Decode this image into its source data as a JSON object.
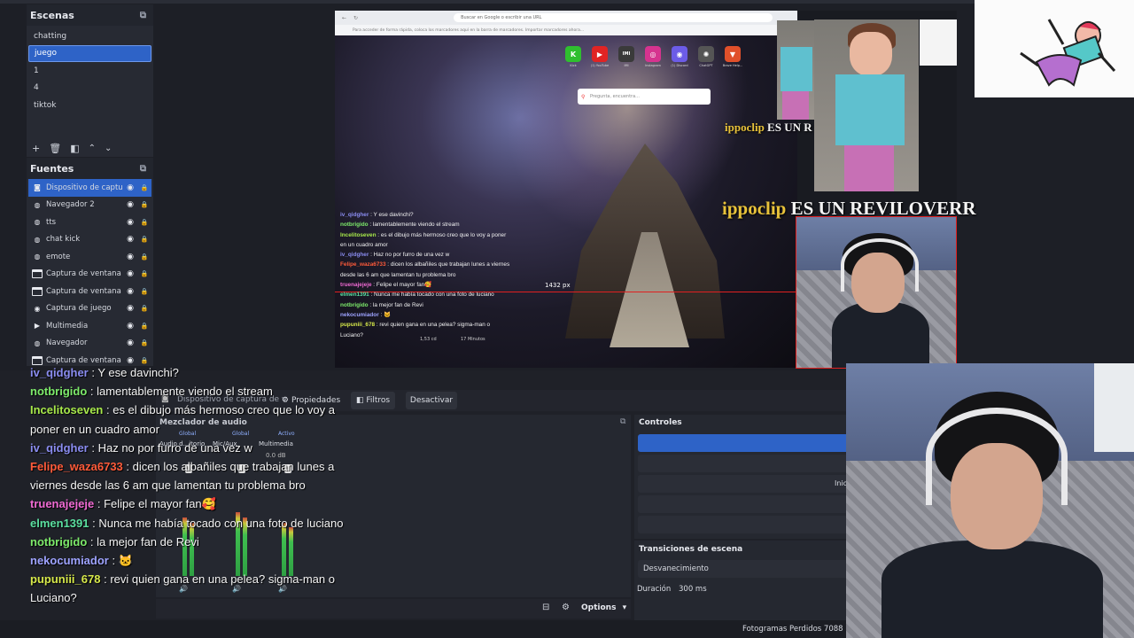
{
  "scenes": {
    "title": "Escenas",
    "items": [
      "chatting",
      "juego",
      "1",
      "4",
      "tiktok"
    ],
    "selected": "juego",
    "toolbar": [
      "+",
      "🗑",
      "◧",
      "^",
      "v"
    ]
  },
  "sources": {
    "title": "Fuentes",
    "items": [
      {
        "label": "Dispositivo de captur",
        "icon": "camera-icon"
      },
      {
        "label": "Navegador 2",
        "icon": "globe-icon"
      },
      {
        "label": "tts",
        "icon": "globe-icon"
      },
      {
        "label": "chat kick",
        "icon": "globe-icon"
      },
      {
        "label": "emote",
        "icon": "globe-icon"
      },
      {
        "label": "Captura de ventana 3",
        "icon": "window-icon"
      },
      {
        "label": "Captura de ventana 2",
        "icon": "window-icon"
      },
      {
        "label": "Captura de juego",
        "icon": "gamepad-icon"
      },
      {
        "label": "Multimedia",
        "icon": "play-icon"
      },
      {
        "label": "Navegador",
        "icon": "globe-icon"
      },
      {
        "label": "Captura de ventana",
        "icon": "window-icon"
      }
    ]
  },
  "preview": {
    "browser_address": "Buscar en Google o escribir una URL",
    "info_bar": "Para acceder de forma rápida, coloca los marcadores aquí en la barra de marcadores.  Importar marcadores ahora...",
    "shortcuts": [
      {
        "label": "Kick",
        "glyph": "K",
        "color": "#2fbf2f"
      },
      {
        "label": "(1) YouTube",
        "glyph": "▶",
        "color": "#e02424"
      },
      {
        "label": "IMI",
        "glyph": "IMI",
        "color": "#3a3a3a"
      },
      {
        "label": "Instagram",
        "glyph": "◎",
        "color": "#d6338f"
      },
      {
        "label": "(1) Discord",
        "glyph": "◉",
        "color": "#6c5ce7"
      },
      {
        "label": "ChatGPT",
        "glyph": "✺",
        "color": "#555"
      },
      {
        "label": "Brave Help...",
        "glyph": "▼",
        "color": "#e0502a"
      }
    ],
    "search_placeholder": "Pregunta, encuentra...",
    "px_label": "1432 px",
    "small_stat_1": "1,53 cd",
    "small_stat_2": "17 Minutos"
  },
  "overlay_text": {
    "user": "ippoclip",
    "rest_small": "ES UN R",
    "rest_big": "ES UN REVILOVERR"
  },
  "chat": [
    {
      "user": "iv_qidgher",
      "color": "#8a8cf0",
      "text": "Y ese davinchi?"
    },
    {
      "user": "notbrigido",
      "color": "#7dea6a",
      "text": "lamentablemente viendo el stream"
    },
    {
      "user": "Incelitoseven",
      "color": "#a7e84a",
      "text": "es el dibujo más hermoso creo que lo voy a poner en un cuadro amor"
    },
    {
      "user": "iv_qidgher",
      "color": "#8a8cf0",
      "text": "Haz no por furro de una vez w"
    },
    {
      "user": "Felipe_waza6733",
      "color": "#ff5b3a",
      "text": "dicen los albañiles que trabajan lunes a viernes desde las 6 am que lamentan tu problema bro"
    },
    {
      "user": "truenajejeje",
      "color": "#ef6ad2",
      "text": "Felipe el mayor fan🥰"
    },
    {
      "user": "elmen1391",
      "color": "#5be0a0",
      "text": "Nunca me había tocado con una foto de luciano"
    },
    {
      "user": "notbrigido",
      "color": "#7dea6a",
      "text": "la mejor fan de Revi"
    },
    {
      "user": "nekocumiador",
      "color": "#9ea3ff",
      "text": "🐱"
    },
    {
      "user": "pupuniii_678",
      "color": "#d6e84a",
      "text": "revi quien gana en una pelea? sigma-man o Luciano?"
    }
  ],
  "source_bar": {
    "source_name": "Dispositivo de captura de v",
    "properties": "Propiedades",
    "filters": "Filtros",
    "deactivate": "Desactivar"
  },
  "mixer": {
    "title": "Mezclador de audio",
    "channels": [
      "Audio d...itorio",
      "Mic/Aux",
      "Multimedia"
    ],
    "tags": [
      "Global",
      "Global",
      "Activo"
    ],
    "db": "0.0 dB",
    "levels": [
      0.55,
      0.6,
      0.5
    ]
  },
  "controls": {
    "title": "Controles",
    "start_label": "Inic"
  },
  "transitions": {
    "title": "Transiciones de escena",
    "selected": "Desvanecimiento",
    "duration_label": "Duración",
    "duration_value": "300 ms"
  },
  "bottom_toolbar": {
    "options": "Options"
  },
  "status": {
    "dropped_frames": "Fotogramas Perdidos 7088 (12"
  }
}
